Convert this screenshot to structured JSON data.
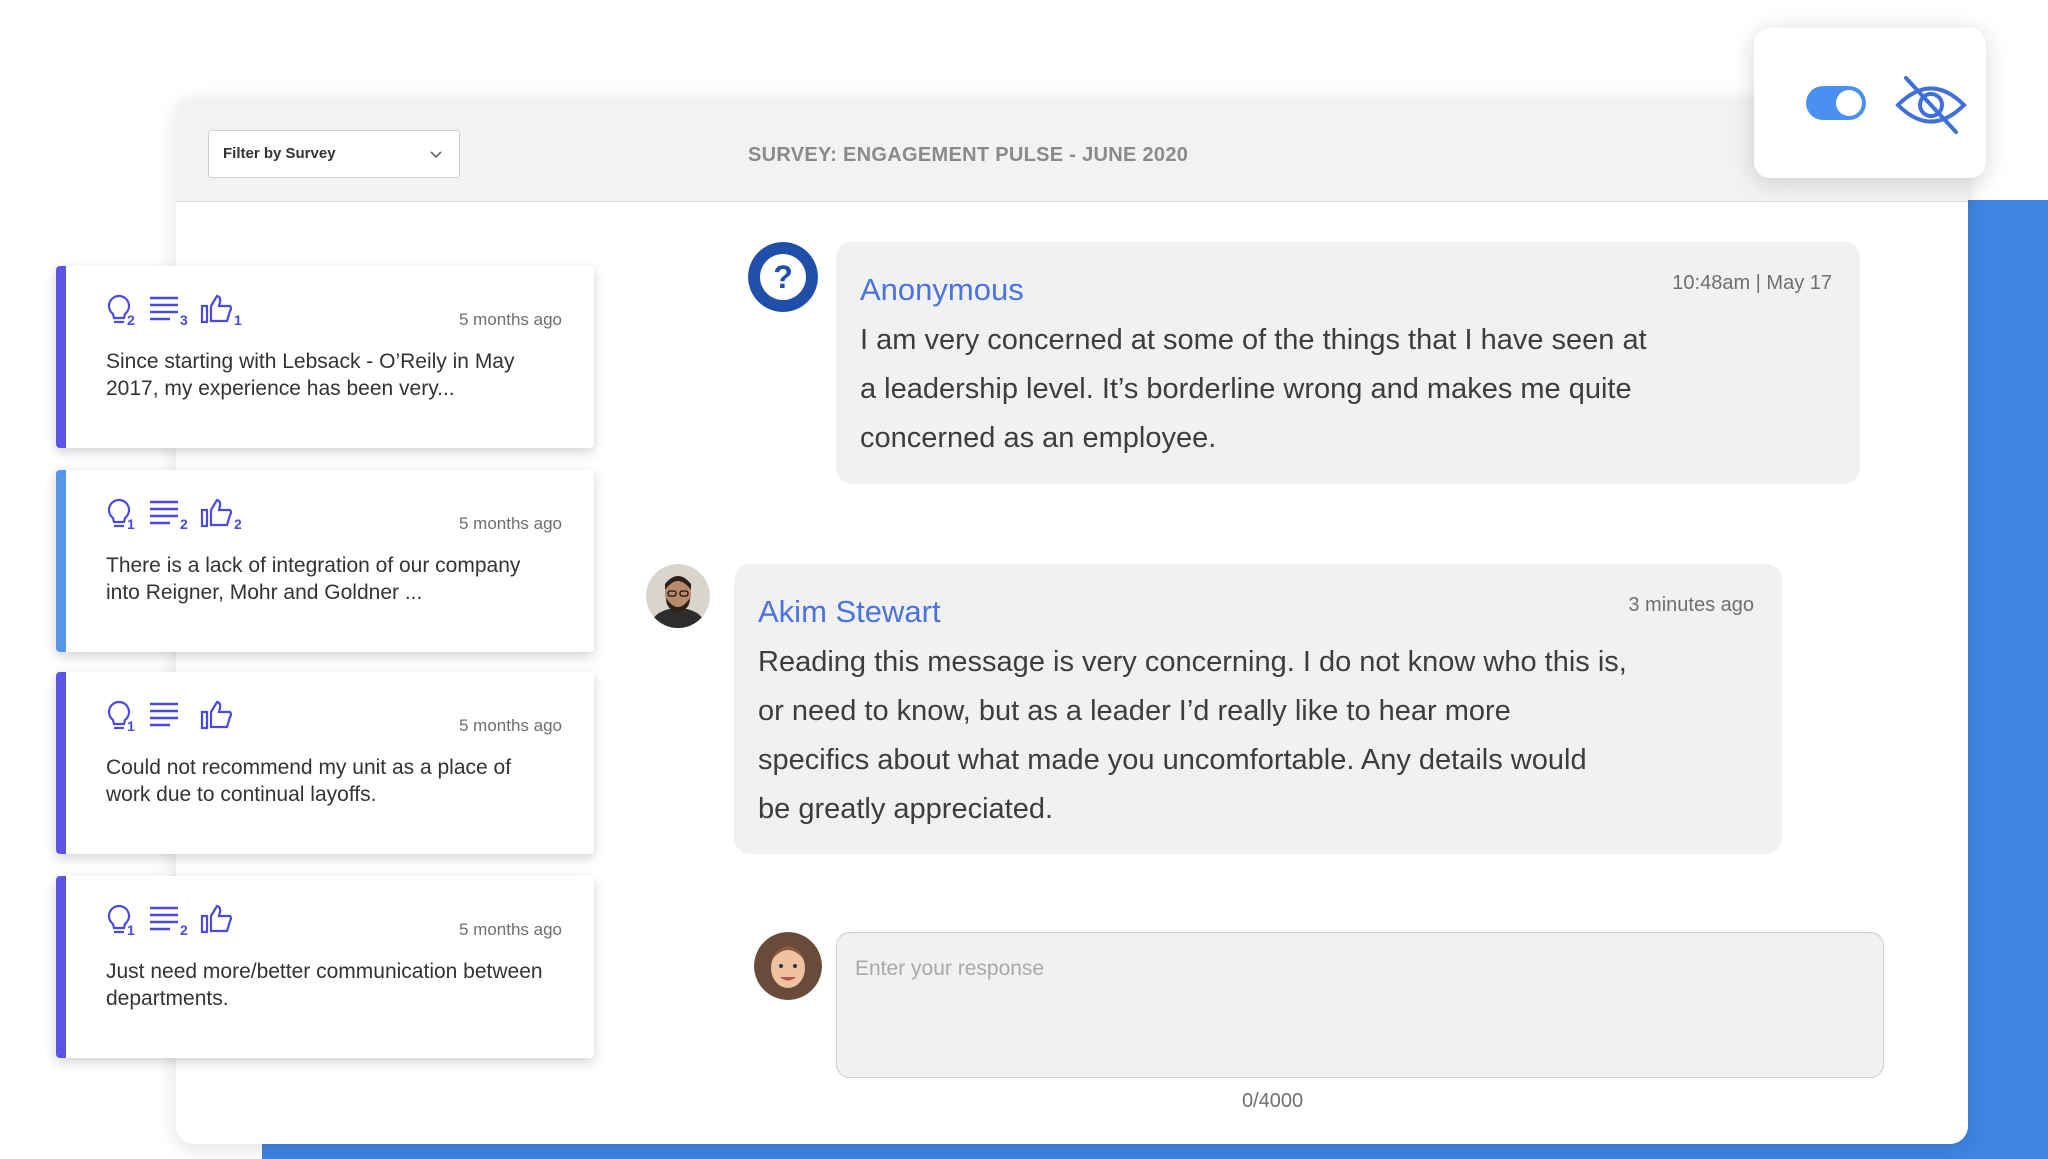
{
  "header": {
    "filter_label": "Filter by Survey",
    "survey_title": "SURVEY: ENGAGEMENT PULSE - JUNE 2020"
  },
  "visibility": {
    "toggle_on": true,
    "toggle_icon": "toggle-switch-icon",
    "eye_icon": "eye-off-icon"
  },
  "colors": {
    "accent_purple": "#5b54e6",
    "accent_blue": "#5596e8",
    "backdrop_blue": "#3f85e3",
    "author_blue": "#4a73e0"
  },
  "comments": [
    {
      "ideas": "2",
      "notes": "3",
      "likes": "1",
      "time": "5 months ago",
      "text": "Since starting with Lebsack - O’Reily in May 2017, my experience has been very..."
    },
    {
      "ideas": "1",
      "notes": "2",
      "likes": "2",
      "time": "5 months ago",
      "text": "There is a lack of integration of our company into Reigner, Mohr and Goldner ..."
    },
    {
      "ideas": "1",
      "notes": "",
      "likes": "",
      "time": "5 months ago",
      "text": "Could not recommend my unit as a place of work due to continual layoffs."
    },
    {
      "ideas": "1",
      "notes": "2",
      "likes": "",
      "time": "5 months ago",
      "text": "Just need more/better communication between departments."
    }
  ],
  "thread": {
    "original": {
      "author": "Anonymous",
      "time": "10:48am | May 17",
      "lines": [
        "I am very concerned at some of the things that I have seen at",
        "a leadership level. It’s borderline wrong and makes me quite",
        "concerned as an employee."
      ]
    },
    "reply": {
      "author": "Akim Stewart",
      "time": "3 minutes ago",
      "lines": [
        "Reading this message is very concerning. I do not know who this is,",
        "or need to know, but as a leader I’d really like to hear more",
        "specifics about what made you uncomfortable. Any details would",
        "be greatly appreciated."
      ]
    }
  },
  "response": {
    "placeholder": "Enter your response",
    "counter": "0/4000"
  }
}
